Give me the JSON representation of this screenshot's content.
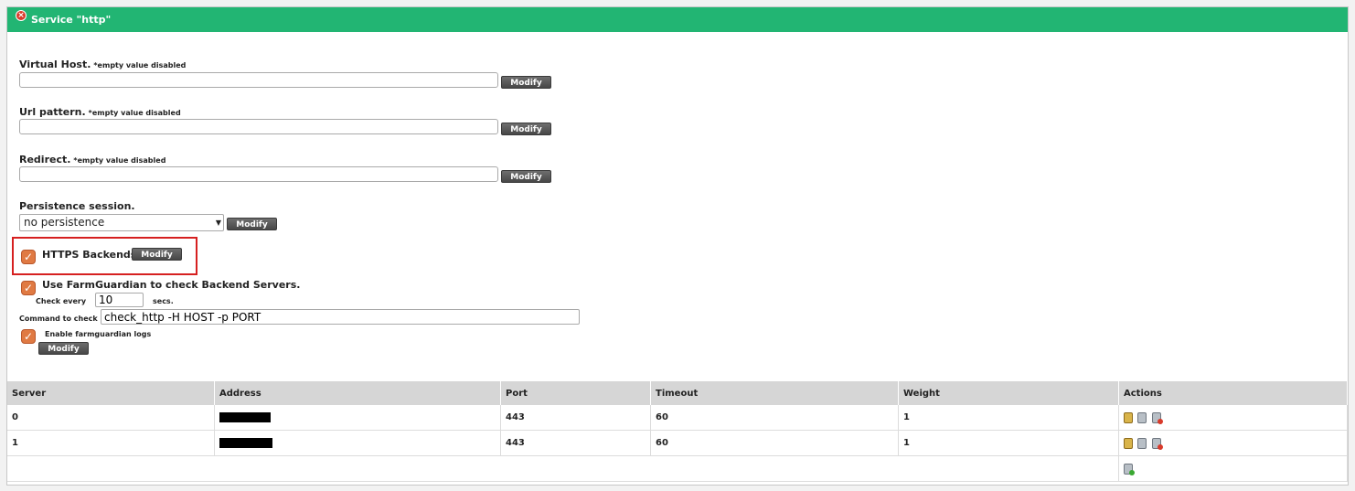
{
  "header": {
    "title": "Service \"http\"",
    "accent_color": "#22b573"
  },
  "form": {
    "virtual_host": {
      "label": "Virtual Host.",
      "note": "*empty value disabled",
      "value": "",
      "button": "Modify"
    },
    "url_pattern": {
      "label": "Url pattern.",
      "note": "*empty value disabled",
      "value": "",
      "button": "Modify"
    },
    "redirect": {
      "label": "Redirect.",
      "note": "*empty value disabled",
      "value": "",
      "button": "Modify"
    },
    "persistence": {
      "label": "Persistence session.",
      "selected": "no persistence",
      "button": "Modify"
    },
    "https_backends": {
      "label": "HTTPS Backends.",
      "checked": true,
      "button": "Modify"
    },
    "farmguardian": {
      "label": "Use FarmGuardian to check Backend Servers.",
      "checked": true,
      "check_every_label": "Check every",
      "check_every_value": "10",
      "secs_label": "secs.",
      "command_label": "Command to check",
      "command_value": "check_http -H HOST -p PORT",
      "logs_label": "Enable farmguardian logs",
      "logs_checked": true,
      "button": "Modify"
    }
  },
  "table": {
    "columns": [
      "Server",
      "Address",
      "Port",
      "Timeout",
      "Weight",
      "Actions"
    ],
    "rows": [
      {
        "server": "0",
        "port": "443",
        "timeout": "60",
        "weight": "1"
      },
      {
        "server": "1",
        "port": "443",
        "timeout": "60",
        "weight": "1"
      }
    ]
  }
}
